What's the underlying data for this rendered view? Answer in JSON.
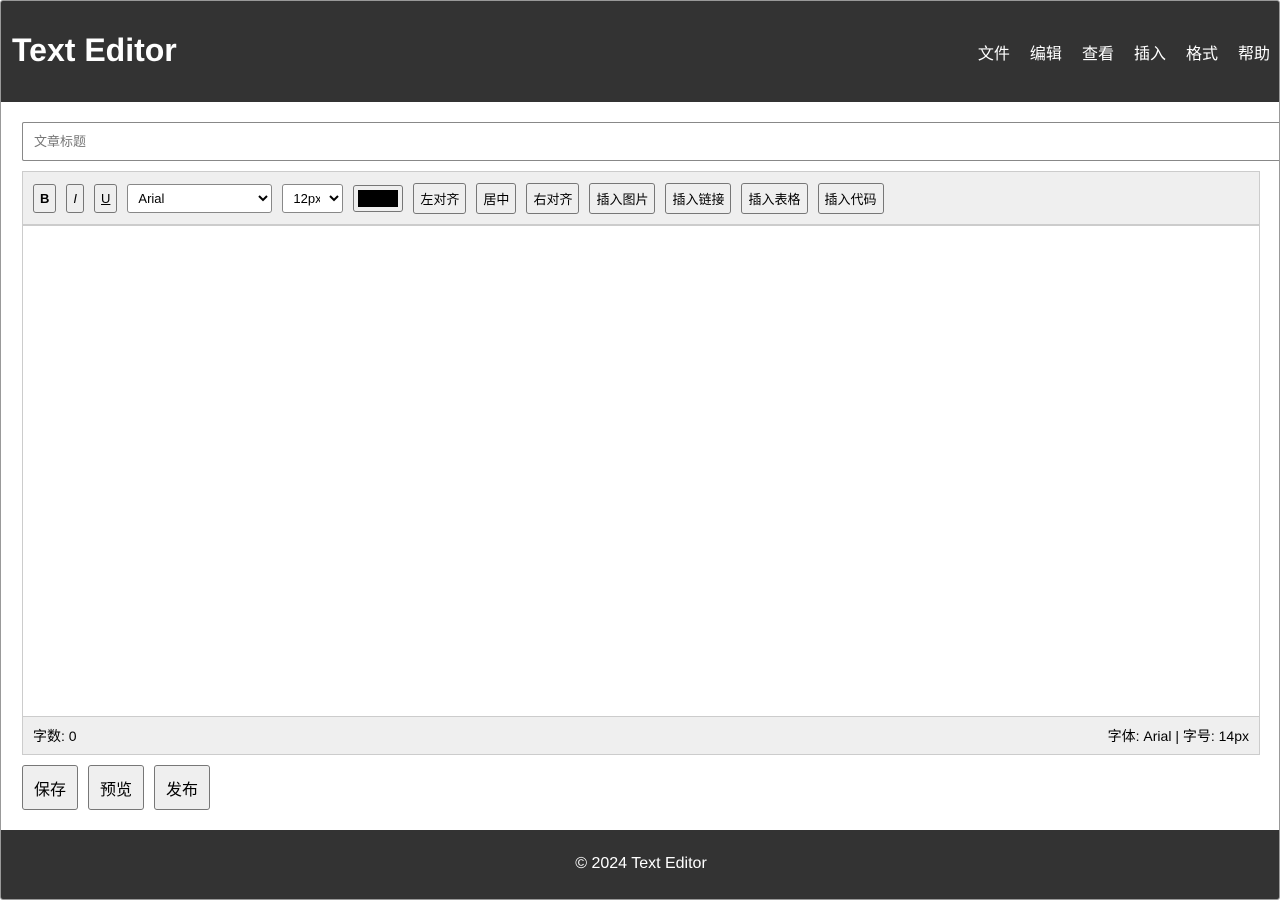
{
  "header": {
    "title": "Text Editor",
    "menu": [
      "文件",
      "编辑",
      "查看",
      "插入",
      "格式",
      "帮助"
    ]
  },
  "title_input": {
    "placeholder": "文章标题",
    "value": ""
  },
  "toolbar": {
    "bold": "B",
    "italic": "I",
    "underline": "U",
    "font": "Arial",
    "size": "12px",
    "color": "#000000",
    "align_left": "左对齐",
    "align_center": "居中",
    "align_right": "右对齐",
    "insert_image": "插入图片",
    "insert_link": "插入链接",
    "insert_table": "插入表格",
    "insert_code": "插入代码"
  },
  "status": {
    "word_count": "字数: 0",
    "font_info": "字体: Arial | 字号: 14px"
  },
  "actions": {
    "save": "保存",
    "preview": "预览",
    "publish": "发布"
  },
  "footer": {
    "text": "© 2024 Text Editor"
  }
}
